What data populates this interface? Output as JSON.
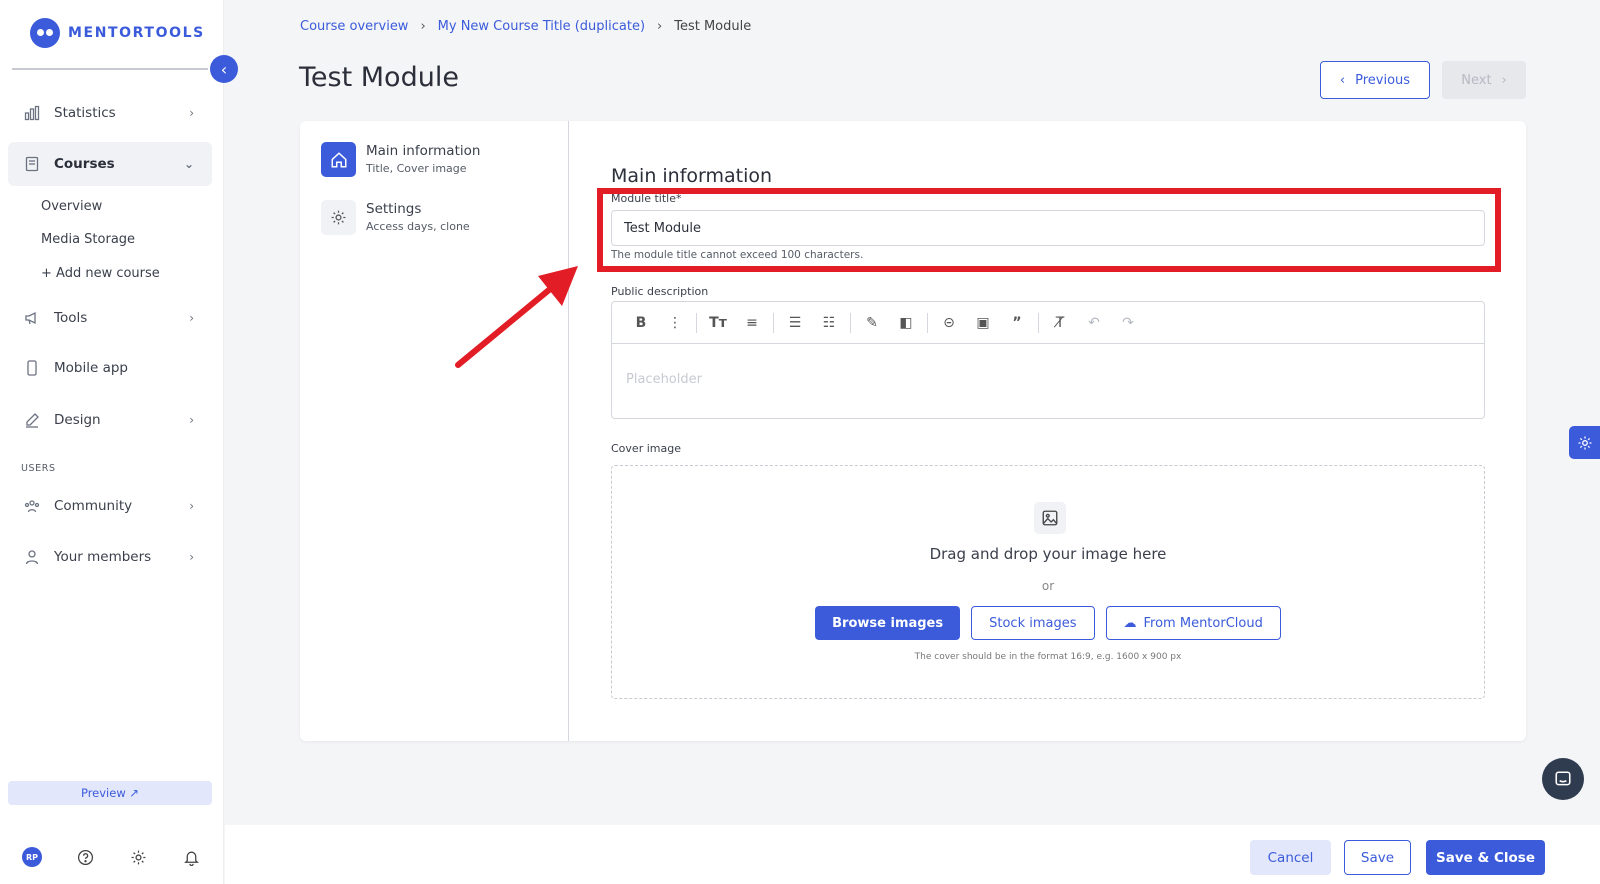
{
  "brand": {
    "name": "MENTORTOOLS",
    "accent": "#3b5bdb"
  },
  "sidebar": {
    "items": [
      {
        "label": "Statistics",
        "icon": "bar-chart-icon"
      },
      {
        "label": "Courses",
        "icon": "book-icon"
      },
      {
        "label": "Tools",
        "icon": "megaphone-icon"
      },
      {
        "label": "Mobile app",
        "icon": "mobile-icon"
      },
      {
        "label": "Design",
        "icon": "pen-icon"
      },
      {
        "label": "Community",
        "icon": "community-icon"
      },
      {
        "label": "Your members",
        "icon": "user-icon"
      }
    ],
    "courses_sub": [
      "Overview",
      "Media Storage",
      "+ Add new course"
    ],
    "section_users": "USERS",
    "preview": "Preview ↗",
    "avatar_initials": "RP"
  },
  "breadcrumb": {
    "items": [
      "Course overview",
      "My New Course Title (duplicate)"
    ],
    "current": "Test Module"
  },
  "page": {
    "title": "Test Module",
    "prev_label": "Previous",
    "next_label": "Next"
  },
  "steps": [
    {
      "title": "Main information",
      "sub": "Title, Cover image"
    },
    {
      "title": "Settings",
      "sub": "Access days, clone"
    }
  ],
  "form": {
    "section_title": "Main information",
    "module_title_label": "Module title*",
    "module_title_value": "Test Module",
    "module_title_hint": "The module title cannot exceed 100 characters.",
    "description_label": "Public description",
    "description_placeholder": "Placeholder",
    "cover_label": "Cover image",
    "dropzone_text": "Drag and drop your image here",
    "dropzone_or": "or",
    "browse": "Browse images",
    "stock": "Stock images",
    "cloud": "From MentorCloud",
    "cover_note": "The cover should be in the format 16:9, e.g. 1600 x 900 px"
  },
  "footer": {
    "cancel": "Cancel",
    "save": "Save",
    "save_close": "Save & Close"
  },
  "annotation": {
    "color": "#e21d25"
  }
}
